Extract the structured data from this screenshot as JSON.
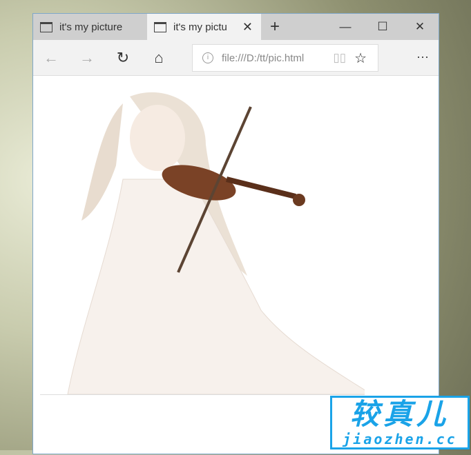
{
  "tabs": [
    {
      "title": "it's my picture",
      "active": false
    },
    {
      "title": "it's my pictu",
      "active": true
    }
  ],
  "new_tab": "+",
  "window_controls": {
    "minimize": "—",
    "maximize": "☐",
    "close": "✕"
  },
  "nav": {
    "back": "←",
    "forward": "→",
    "refresh": "↻",
    "home": "⌂",
    "more": "···"
  },
  "address": {
    "url": "file:///D:/tt/pic.html",
    "info": "i"
  },
  "watermark": {
    "cn": "较真儿",
    "en": "jiaozhen.cc",
    "color": "#1aa3e8"
  }
}
